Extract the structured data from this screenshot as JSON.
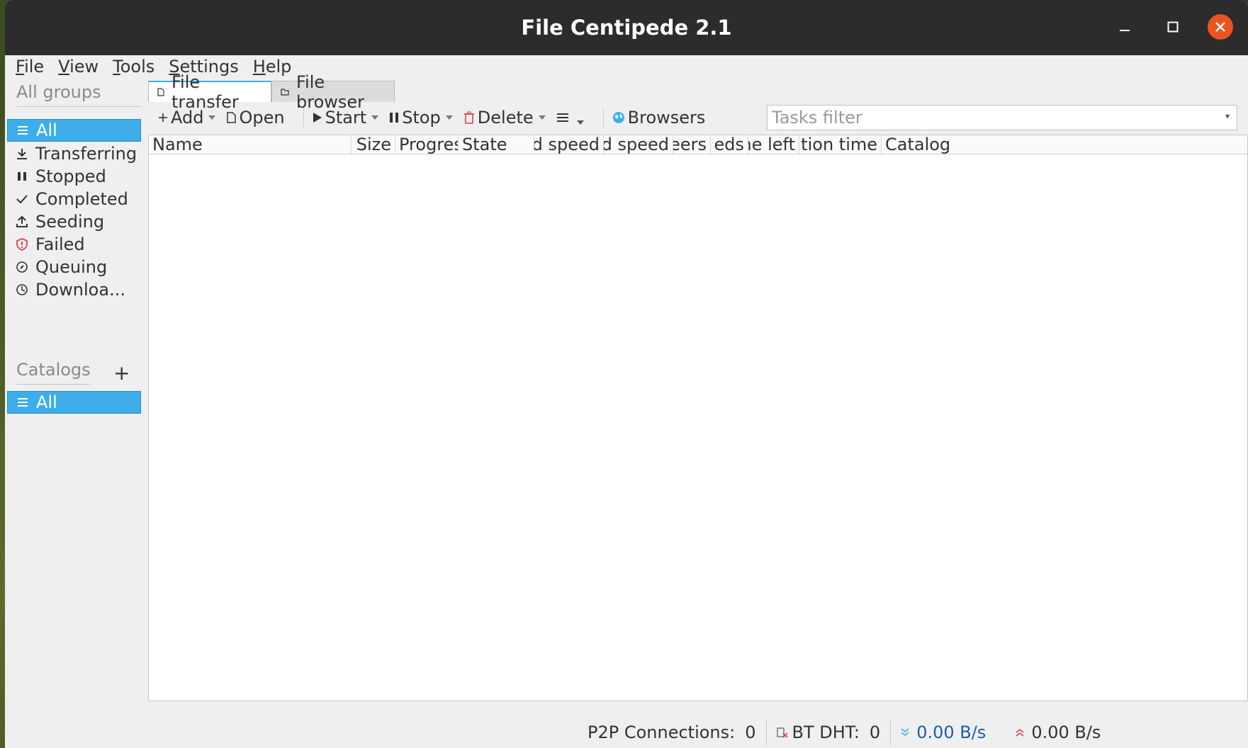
{
  "window": {
    "title": "File Centipede 2.1"
  },
  "menu": [
    {
      "key": "F",
      "rest": "ile"
    },
    {
      "key": "V",
      "rest": "iew"
    },
    {
      "key": "T",
      "rest": "ools"
    },
    {
      "key": "S",
      "rest": "ettings"
    },
    {
      "key": "H",
      "rest": "elp"
    }
  ],
  "sidebar": {
    "groups_heading": "All groups",
    "groups": [
      {
        "label": "All",
        "icon": "list-icon",
        "active": true
      },
      {
        "label": "Transferring",
        "icon": "download-icon"
      },
      {
        "label": "Stopped",
        "icon": "pause-icon"
      },
      {
        "label": "Completed",
        "icon": "check-icon"
      },
      {
        "label": "Seeding",
        "icon": "upload-icon"
      },
      {
        "label": "Failed",
        "icon": "error-shield-icon",
        "color": "#da4453"
      },
      {
        "label": "Queuing",
        "icon": "compass-icon"
      },
      {
        "label": "Downloa...",
        "icon": "clock-icon"
      }
    ],
    "catalogs_heading": "Catalogs",
    "catalogs": [
      {
        "label": "All",
        "icon": "list-icon",
        "active": true
      }
    ]
  },
  "tabs": [
    {
      "label": "File transfer",
      "active": true
    },
    {
      "label": "File browser",
      "active": false
    }
  ],
  "toolbar": {
    "add": "Add",
    "open": "Open",
    "start": "Start",
    "stop": "Stop",
    "delete": "Delete",
    "browsers": "Browsers",
    "filter_placeholder": "Tasks filter"
  },
  "table": {
    "columns": [
      "Name",
      "Size",
      "Progress",
      "State",
      "d speed",
      "d speed",
      "eers",
      "eds",
      "ne left",
      "ation time",
      "Catalog"
    ],
    "rows": []
  },
  "status": {
    "p2p_label": "P2P Connections:",
    "p2p_value": "0",
    "dht_label": "BT DHT:",
    "dht_value": "0",
    "down_speed": "0.00 B/s",
    "up_speed": "0.00 B/s"
  },
  "colors": {
    "accent": "#3daee9",
    "close": "#e95420",
    "down": "#1d5ea8",
    "up": "#c0392b"
  }
}
